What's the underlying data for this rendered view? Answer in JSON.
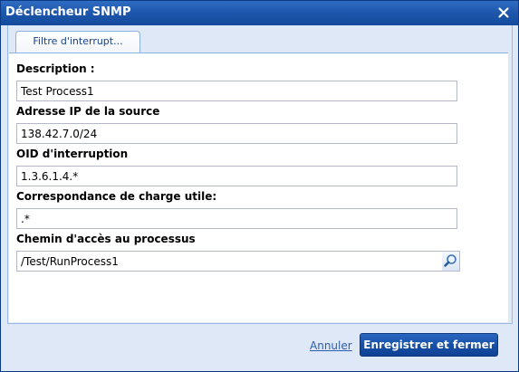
{
  "window": {
    "title": "Déclencheur SNMP"
  },
  "tabs": [
    {
      "label": "Filtre d'interrupt..."
    }
  ],
  "form": {
    "description": {
      "label": "Description :",
      "value": "Test Process1"
    },
    "source_ip": {
      "label": "Adresse IP de la source",
      "value": "138.42.7.0/24"
    },
    "trap_oid": {
      "label": "OID d'interruption",
      "value": "1.3.6.1.4.*"
    },
    "payload_match": {
      "label": "Correspondance de charge utile:",
      "value": ".*"
    },
    "process_path": {
      "label": "Chemin d'accès au processus",
      "value": "/Test/RunProcess1"
    }
  },
  "footer": {
    "cancel_label": "Annuler",
    "save_label": "Enregistrer et fermer"
  },
  "icons": {
    "close": "close-icon",
    "browse": "search-icon"
  },
  "colors": {
    "titlebar": "#1d56ab",
    "accent_button": "#164fa5",
    "link": "#2a5db0"
  }
}
